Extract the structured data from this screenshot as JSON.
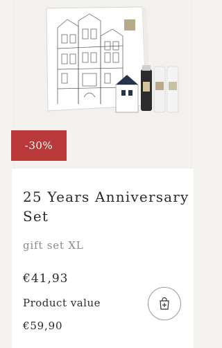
{
  "product": {
    "discount": "-30%",
    "title": "25 Years Anniversary Set",
    "subtitle": "gift set XL",
    "price": "€41,93",
    "product_value_label": "Product value",
    "old_price": "€59,90"
  },
  "icons": {
    "cart": "shopping-bag-add-icon"
  },
  "colors": {
    "badge": "#b9393b",
    "background": "#f6f4f1"
  }
}
